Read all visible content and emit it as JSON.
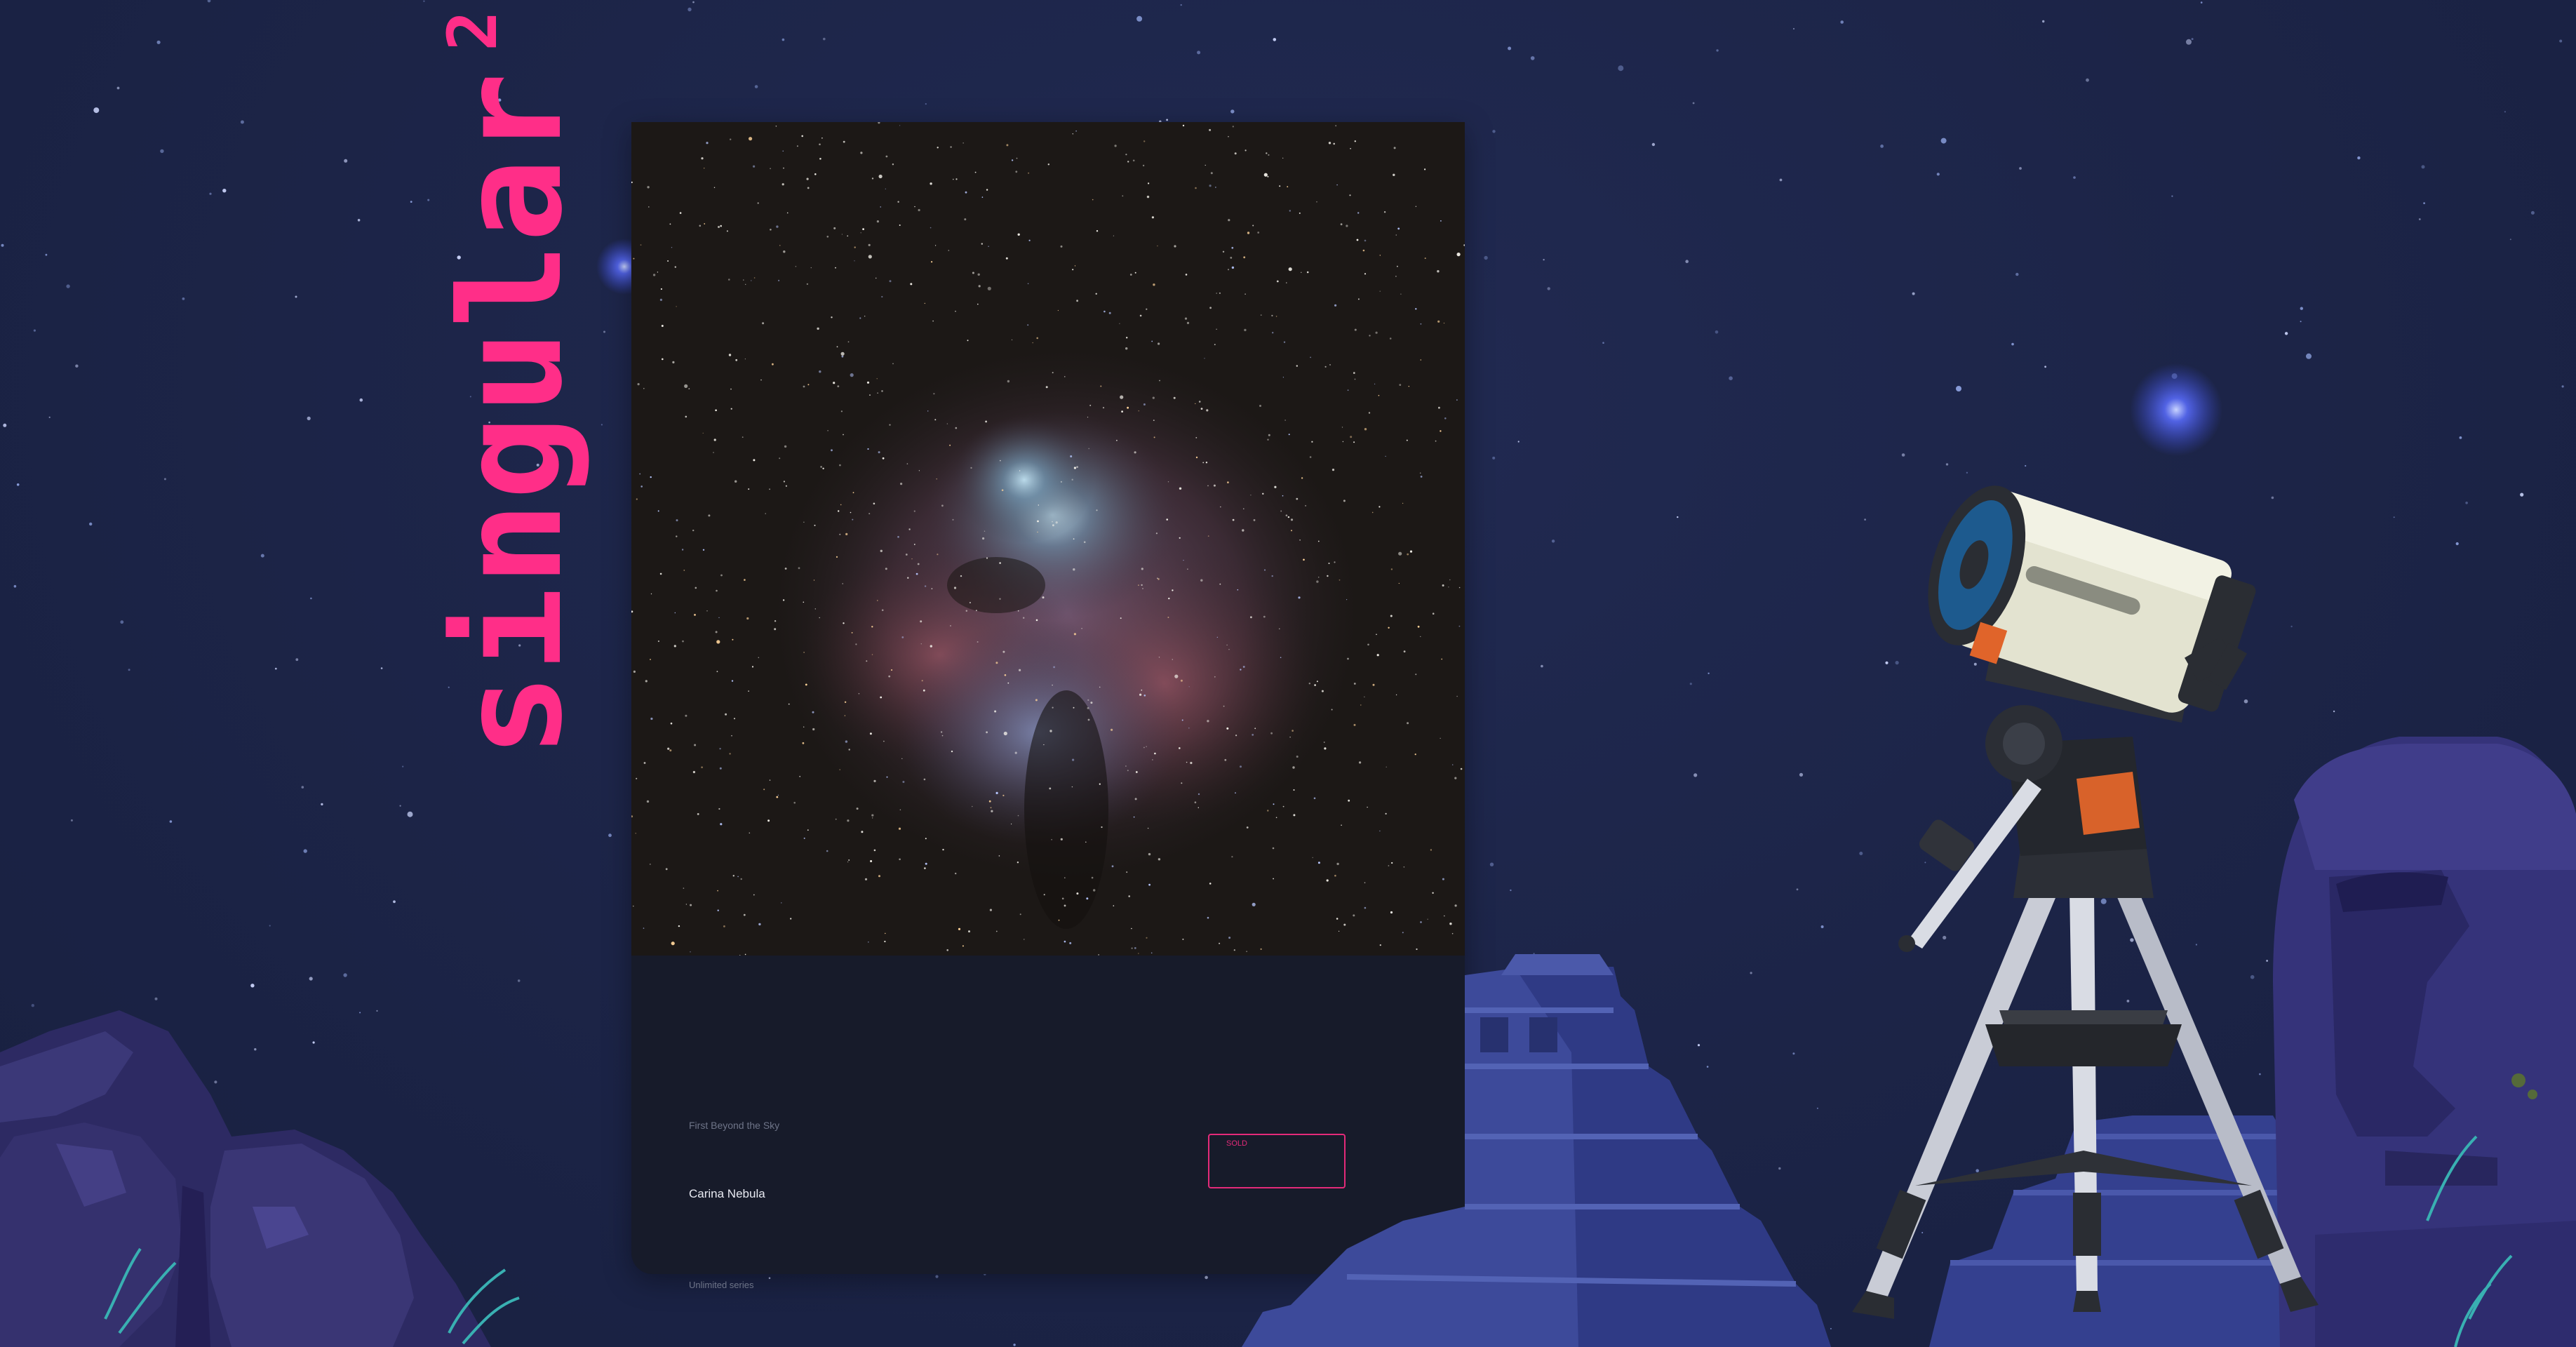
{
  "brand": {
    "name": "singular",
    "version": "2.0",
    "color": "#ff2e88"
  },
  "artwork": {
    "collection": "First Beyond the Sky",
    "title": "Carina Nebula",
    "badge": "SOLD",
    "series": "Unlimited series"
  },
  "colors": {
    "background": "#1c2447",
    "card": "#171b2a",
    "accent": "#e42a79"
  }
}
